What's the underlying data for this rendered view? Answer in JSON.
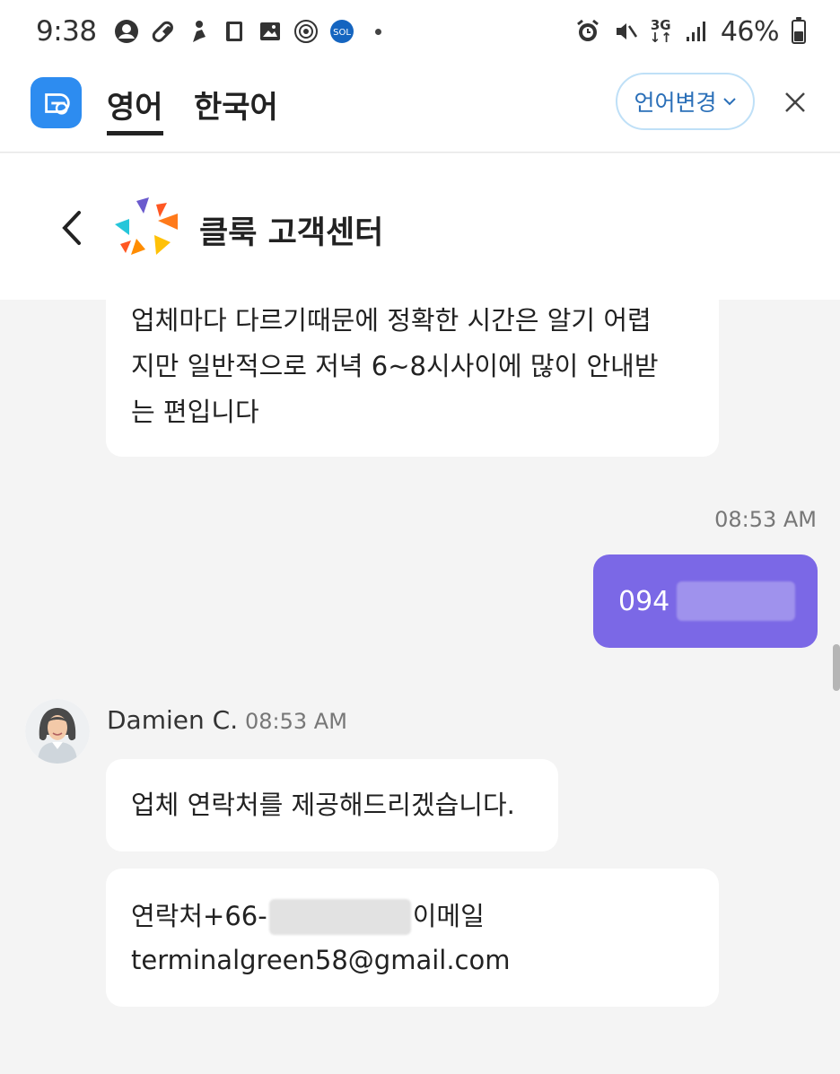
{
  "status_bar": {
    "time": "9:38",
    "left_icons": [
      "account-icon",
      "pill-icon",
      "figure-icon",
      "book-icon",
      "gallery-icon",
      "badge-icon",
      "super-sol-app-icon"
    ],
    "right_icons": [
      "alarm-icon",
      "mute-icon",
      "network-3g-icon",
      "signal-icon",
      "battery-icon"
    ],
    "network_label": "3G",
    "battery_percent": "46%",
    "battery_level": 0.46
  },
  "translate_bar": {
    "source_language": "영어",
    "target_language": "한국어",
    "change_language_label": "언어변경"
  },
  "chat_header": {
    "title": "클룩 고객센터"
  },
  "messages": [
    {
      "sender": "agent",
      "lines": [
        "업체마다 다르기때문에 정확한 시간은 알기 어렵",
        "지만 일반적으로 저녁 6~8시사이에 많이 안내받",
        "는 편입니다"
      ]
    },
    {
      "sender": "user",
      "time": "08:53 AM",
      "text": "094"
    },
    {
      "sender": "agent",
      "agent_name": "Damien C.",
      "time": "08:53 AM",
      "text": "업체 연락처를 제공해드리겠습니다."
    },
    {
      "sender": "agent",
      "prefix": "연락처+66-",
      "suffix": "이메일",
      "email": "terminalgreen58@gmail.com"
    }
  ],
  "colors": {
    "user_bubble": "#7b68e6",
    "chat_background": "#f4f4f4",
    "app_logo": "#2d8cf0",
    "language_button_border": "#bfe0f7"
  }
}
